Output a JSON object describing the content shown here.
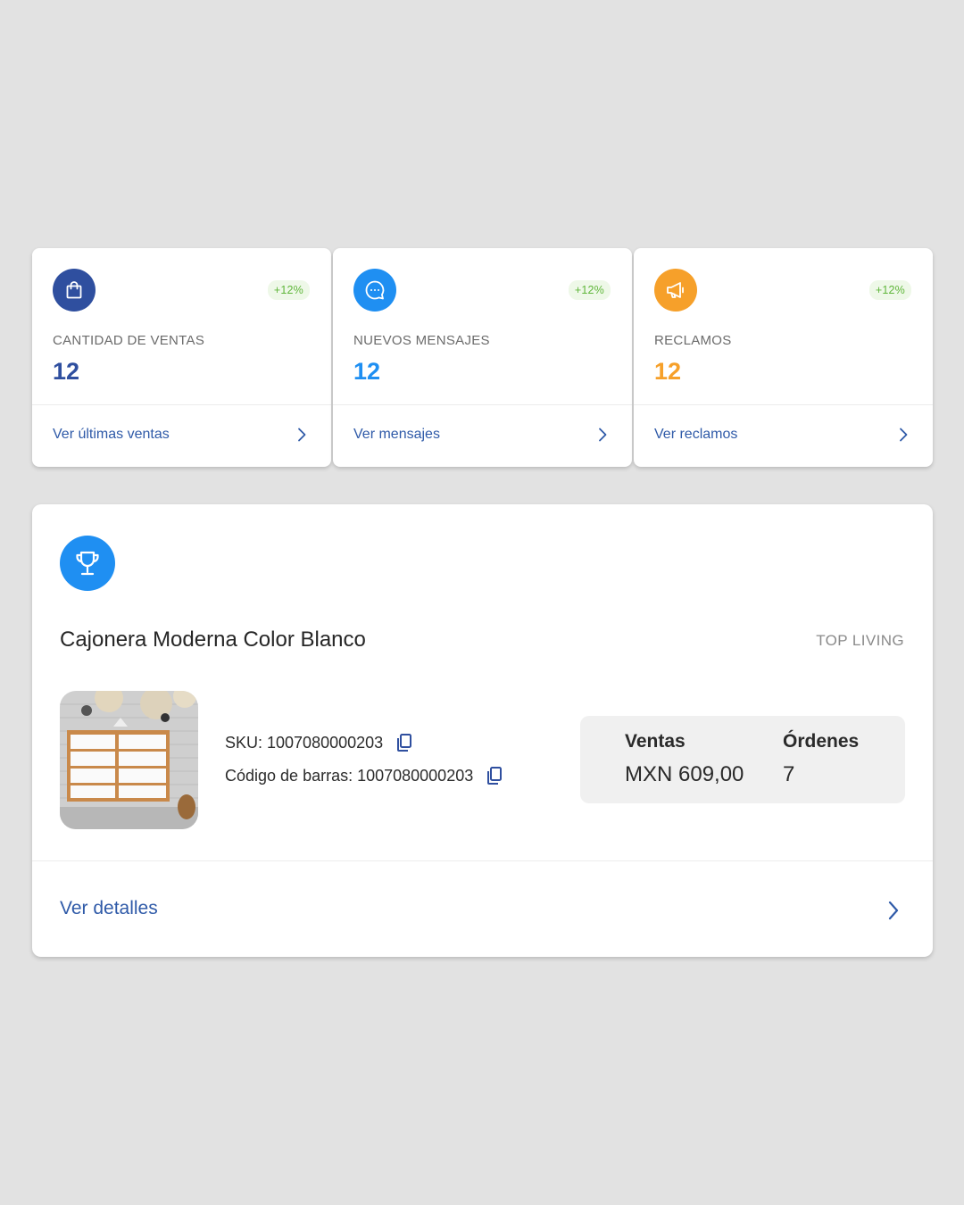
{
  "stats": [
    {
      "icon": "shopping-bag-icon",
      "color": "#2f4f9f",
      "badge": "+12%",
      "label": "CANTIDAD DE VENTAS",
      "value": "12",
      "link": "Ver últimas ventas"
    },
    {
      "icon": "chat-bubble-icon",
      "color": "#1f8ff2",
      "badge": "+12%",
      "label": "NUEVOS MENSAJES",
      "value": "12",
      "link": "Ver mensajes"
    },
    {
      "icon": "megaphone-icon",
      "color": "#f6a02a",
      "badge": "+12%",
      "label": "RECLAMOS",
      "value": "12",
      "link": "Ver reclamos"
    }
  ],
  "product": {
    "icon": "trophy-icon",
    "title": "Cajonera Moderna Color Blanco",
    "brand": "TOP LIVING",
    "sku": "SKU: 1007080000203",
    "barcode": "Código de barras: 1007080000203",
    "metrics": {
      "sales_label": "Ventas",
      "sales_value": "MXN 609,00",
      "orders_label": "Órdenes",
      "orders_value": "7"
    },
    "link": "Ver detalles"
  },
  "colors": {
    "link": "#2f5aa8",
    "badge_bg": "#eef8e8",
    "badge_text": "#5fb63a"
  }
}
